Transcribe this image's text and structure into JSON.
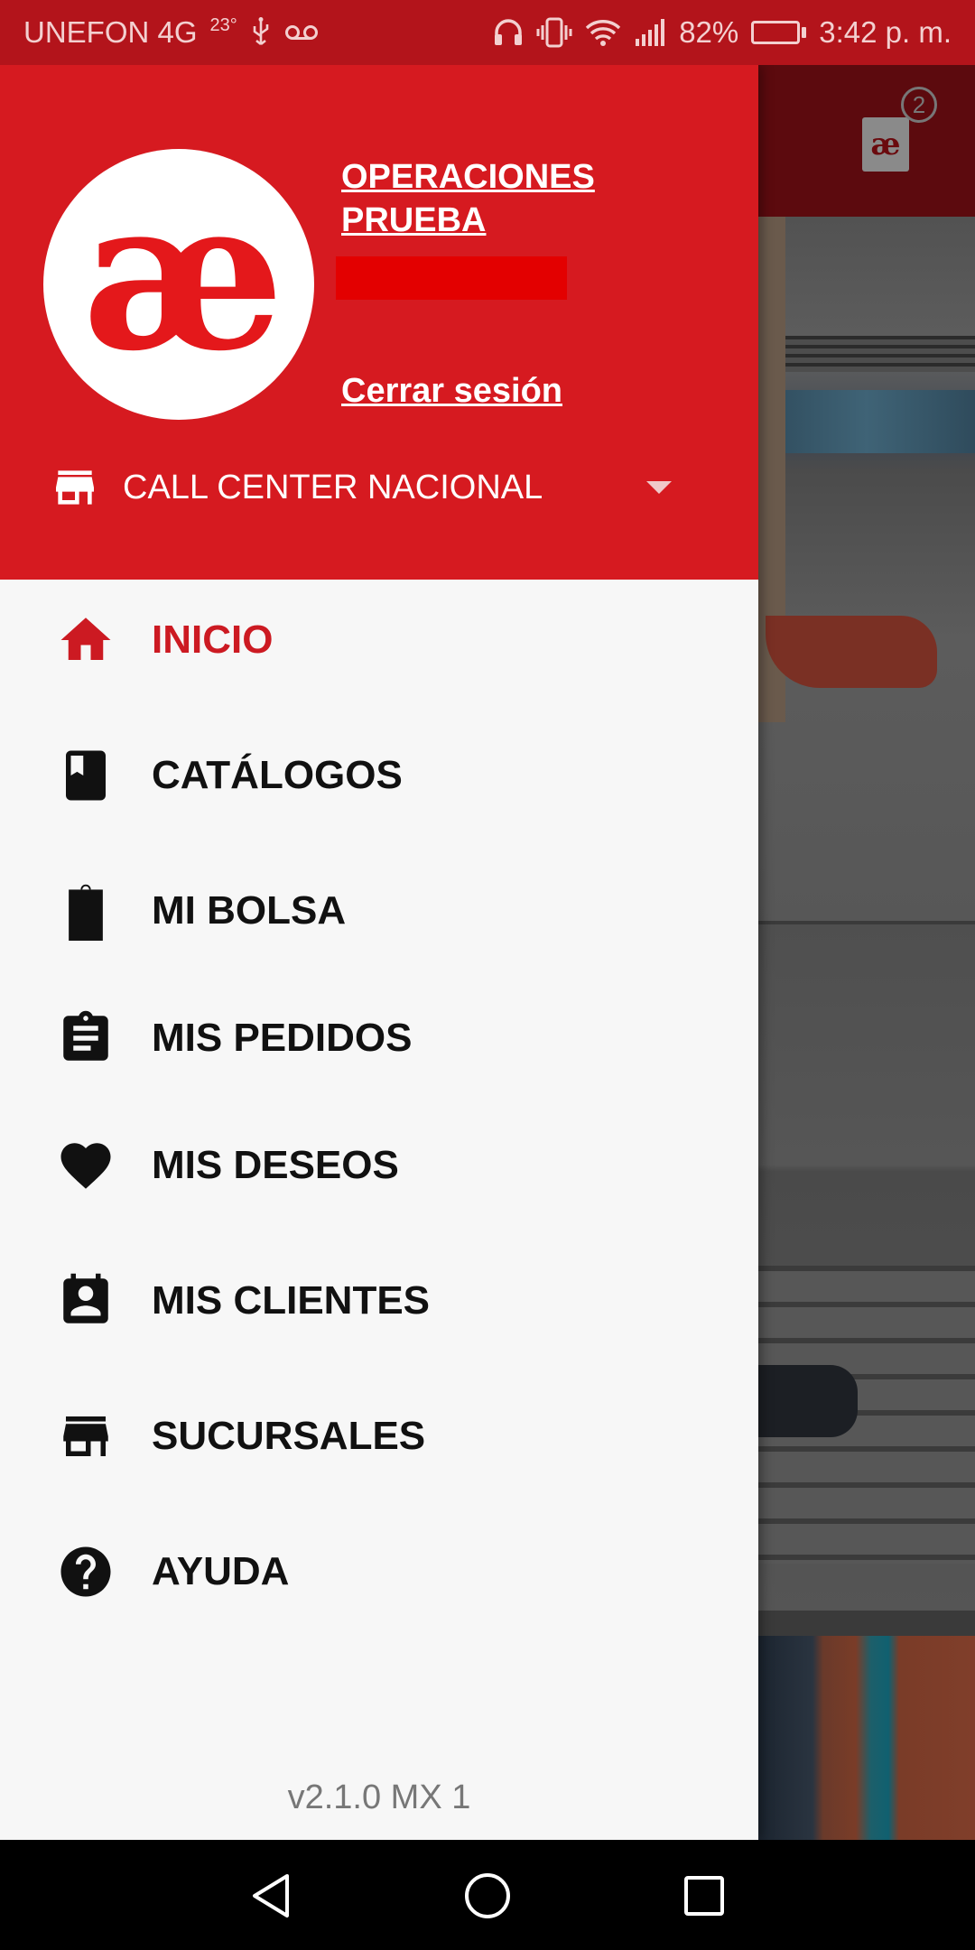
{
  "status_bar": {
    "carrier": "UNEFON 4G",
    "temperature": "23°",
    "battery": "82%",
    "battery_level": 0.82,
    "time": "3:42 p. m.",
    "icons": [
      "usb-icon",
      "voicemail-icon",
      "headphones-icon",
      "vibrate-icon",
      "wifi-icon",
      "signal-icon",
      "battery-charging-icon"
    ]
  },
  "background": {
    "cart_logo": "æ",
    "cart_count": "2"
  },
  "drawer": {
    "logo_text": "æ",
    "user_name": "OPERACIONES PRUEBA",
    "logout": "Cerrar sesión",
    "store": "CALL CENTER NACIONAL",
    "version": "v2.1.0 MX 1",
    "active_color": "#cc1a22",
    "header_color": "#d61a20",
    "menu": [
      {
        "label": "INICIO",
        "icon": "home-icon",
        "active": true
      },
      {
        "label": "CATÁLOGOS",
        "icon": "book-icon",
        "active": false
      },
      {
        "label": "MI BOLSA",
        "icon": "shopping-bag-icon",
        "active": false
      },
      {
        "label": "MIS PEDIDOS",
        "icon": "clipboard-icon",
        "active": false
      },
      {
        "label": "MIS DESEOS",
        "icon": "heart-icon",
        "active": false
      },
      {
        "label": "MIS CLIENTES",
        "icon": "contact-calendar-icon",
        "active": false
      },
      {
        "label": "SUCURSALES",
        "icon": "store-icon",
        "active": false
      },
      {
        "label": "AYUDA",
        "icon": "help-icon",
        "active": false
      }
    ]
  }
}
